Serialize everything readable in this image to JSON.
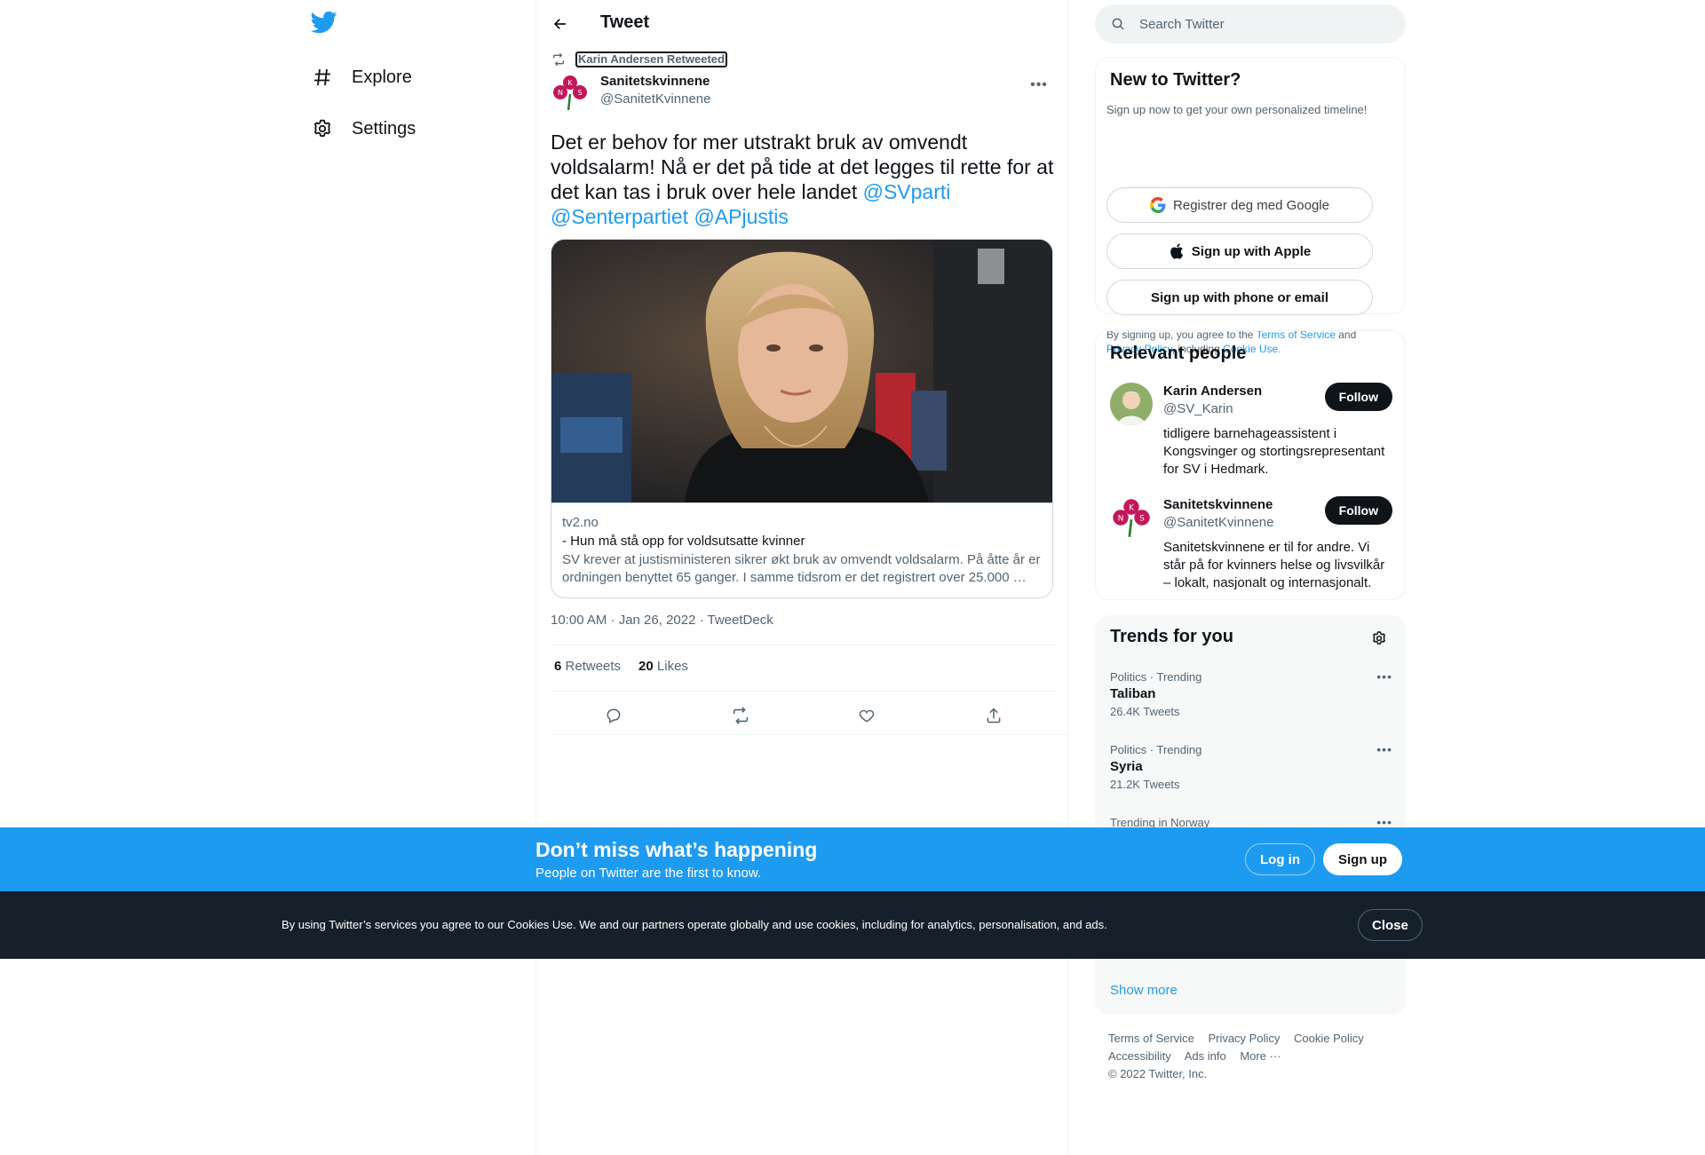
{
  "colors": {
    "accent": "#1d9bf0",
    "text": "#0f1419",
    "muted": "#536471",
    "cookie_bg": "#15202b"
  },
  "nav": {
    "logo_icon": "twitter-bird-icon",
    "items": [
      {
        "label": "Explore",
        "icon": "hashtag-icon"
      },
      {
        "label": "Settings",
        "icon": "gear-icon"
      }
    ]
  },
  "header": {
    "title": "Tweet"
  },
  "tweet": {
    "retweeted_by": "Karin Andersen Retweeted",
    "author_name": "Sanitetskvinnene",
    "author_handle": "@SanitetKvinnene",
    "text": "Det er behov for mer utstrakt bruk av omvendt voldsalarm! Nå er det på tide at det legges til rette for at det kan tas i bruk over hele landet ",
    "mentions": [
      "@SVparti",
      "@Senterpartiet",
      "@APjustis"
    ],
    "card": {
      "domain": "tv2.no",
      "title": "- Hun må stå opp for voldsutsatte kvinner",
      "description": "SV krever at justisministeren sikrer økt bruk av omvendt voldsalarm. På åtte år er ordningen benyttet 65 ganger. I samme tidsrom er det registrert over 25.000 …"
    },
    "timestamp": "10:00 AM · Jan 26, 2022 · TweetDeck",
    "retweets_count": "6",
    "retweets_label": "Retweets",
    "likes_count": "20",
    "likes_label": "Likes"
  },
  "search": {
    "placeholder": "Search Twitter"
  },
  "new_to_twitter": {
    "title": "New to Twitter?",
    "subtitle": "Sign up now to get your own personalized timeline!",
    "google_label": "Registrer deg med Google",
    "apple_label": "Sign up with Apple",
    "phone_label": "Sign up with phone or email",
    "legal_prefix": "By signing up, you agree to the ",
    "terms_link": "Terms of Service",
    "legal_and": " and ",
    "privacy_link": "Privacy Policy",
    "legal_including": ", including ",
    "cookie_link": "Cookie Use."
  },
  "relevant_people": {
    "title": "Relevant people",
    "people": [
      {
        "name": "Karin Andersen",
        "handle": "@SV_Karin",
        "bio": "tidligere barnehageassistent i Kongsvinger og stortingsrepresentant for SV i Hedmark.",
        "follow_label": "Follow"
      },
      {
        "name": "Sanitetskvinnene",
        "handle": "@SanitetKvinnene",
        "bio": "Sanitetskvinnene er til for andre. Vi står på for kvinners helse og livsvilkår – lokalt, nasjonalt og internasjonalt.",
        "follow_label": "Follow"
      }
    ]
  },
  "trends": {
    "title": "Trends for you",
    "items": [
      {
        "category": "Politics · Trending",
        "name": "Taliban",
        "count": "26.4K Tweets"
      },
      {
        "category": "Politics · Trending",
        "name": "Syria",
        "count": "21.2K Tweets"
      },
      {
        "category": "Trending in Norway",
        "name": "",
        "count": ""
      }
    ],
    "show_more": "Show more"
  },
  "footer": {
    "links_row1": [
      "Terms of Service",
      "Privacy Policy",
      "Cookie Policy"
    ],
    "links_row2": [
      "Accessibility",
      "Ads info",
      "More ···"
    ],
    "copyright": "© 2022 Twitter, Inc."
  },
  "bottom_bar": {
    "title": "Don’t miss what’s happening",
    "subtitle": "People on Twitter are the first to know.",
    "login_label": "Log in",
    "signup_label": "Sign up"
  },
  "cookie_bar": {
    "text": "By using Twitter’s services you agree to our Cookies Use. We and our partners operate globally and use cookies, including for analytics, personalisation, and ads.",
    "close_label": "Close"
  }
}
